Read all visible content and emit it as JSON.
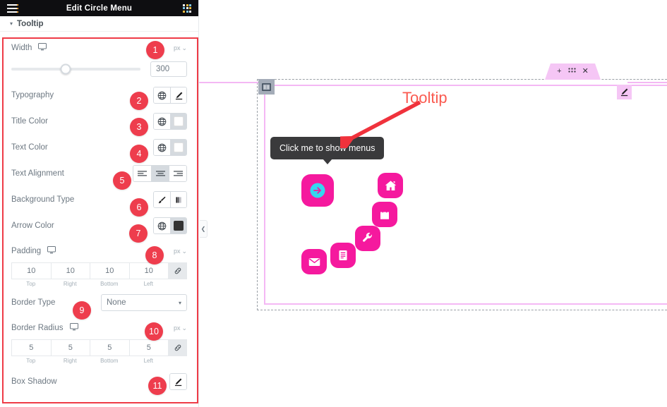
{
  "header": {
    "title": "Edit Circle Menu",
    "menu_icon": "hamburger-icon",
    "apps_icon": "apps-grid-icon"
  },
  "section": {
    "title": "Tooltip",
    "caret": "▾"
  },
  "controls": {
    "width": {
      "label": "Width",
      "device_icon": "desktop-icon",
      "unit": "px",
      "unit_caret": "⌄",
      "value": "300",
      "slider_percent": 42,
      "badge": "1"
    },
    "typography": {
      "label": "Typography",
      "globe_icon": "globe-icon",
      "pencil_icon": "pencil-icon",
      "badge": "2"
    },
    "title_color": {
      "label": "Title Color",
      "globe_icon": "globe-icon",
      "swatch": "#ffffff",
      "badge": "3"
    },
    "text_color": {
      "label": "Text Color",
      "globe_icon": "globe-icon",
      "swatch": "#ffffff",
      "badge": "4"
    },
    "text_alignment": {
      "label": "Text Alignment",
      "options": [
        "align-left-icon",
        "align-center-icon",
        "align-right-icon"
      ],
      "selected": "align-center-icon",
      "badge": "5"
    },
    "background_type": {
      "label": "Background Type",
      "options": [
        "brush-icon",
        "gradient-icon"
      ],
      "badge": "6"
    },
    "arrow_color": {
      "label": "Arrow Color",
      "globe_icon": "globe-icon",
      "swatch": "#333333",
      "badge": "7"
    },
    "padding": {
      "label": "Padding",
      "device_icon": "desktop-icon",
      "unit": "px",
      "unit_caret": "⌄",
      "values": [
        "10",
        "10",
        "10",
        "10"
      ],
      "sides": [
        "Top",
        "Right",
        "Bottom",
        "Left"
      ],
      "link_icon": "link-icon",
      "badge": "8"
    },
    "border_type": {
      "label": "Border Type",
      "value": "None",
      "caret": "▾",
      "badge": "9"
    },
    "border_radius": {
      "label": "Border Radius",
      "device_icon": "desktop-icon",
      "unit": "px",
      "unit_caret": "⌄",
      "values": [
        "5",
        "5",
        "5",
        "5"
      ],
      "sides": [
        "Top",
        "Right",
        "Bottom",
        "Left"
      ],
      "link_icon": "link-icon",
      "badge": "10"
    },
    "box_shadow": {
      "label": "Box Shadow",
      "pencil_icon": "pencil-icon",
      "badge": "11"
    }
  },
  "collapse": {
    "icon": "chevron-left-icon",
    "glyph": "❮"
  },
  "canvas": {
    "section_toolbar": {
      "add": "+",
      "drag": "drag-handle-icon",
      "close": "✕"
    },
    "edit_pencil": "pencil-icon",
    "column_handle": "column-icon",
    "tooltip_text": "Click me to show menus",
    "menu": {
      "main_icon": "arrow-circle-right-icon",
      "items": [
        "home-icon",
        "shopping-bag-icon",
        "wrench-icon",
        "document-icon",
        "envelope-icon"
      ]
    },
    "annotation": {
      "label": "Tooltip",
      "arrow": "arrow-pointing-down-left"
    }
  },
  "colors": {
    "badge_red": "#ee3d4d",
    "highlight_red": "#ef3b47",
    "menu_pink": "#f5199e",
    "main_icon_cyan": "#35d6ef",
    "tooltip_dark": "#3a3a3c",
    "annotation_red": "#fa5a50",
    "column_pink": "#f4b8f4",
    "toolbar_pink": "#f5c6f5"
  }
}
